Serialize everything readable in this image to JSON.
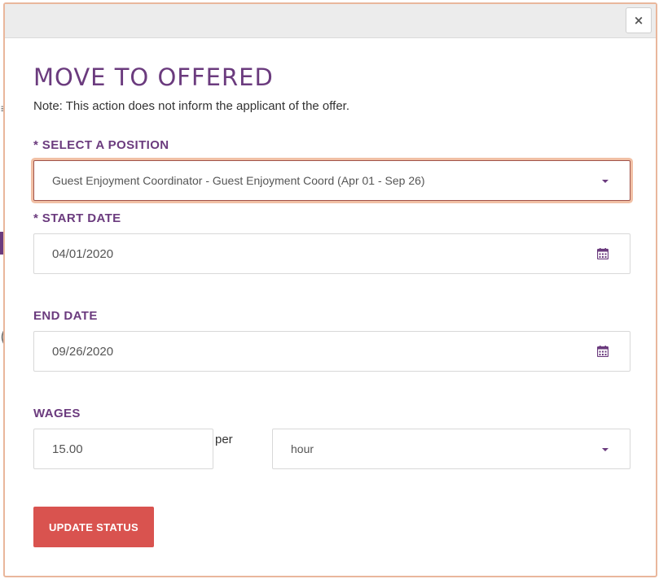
{
  "modal": {
    "close_label": "×",
    "title": "MOVE TO OFFERED",
    "note": "Note: This action does not inform the applicant of the offer."
  },
  "position": {
    "label": "* SELECT A POSITION",
    "value": "Guest Enjoyment Coordinator - Guest Enjoyment Coord (Apr 01 - Sep 26)"
  },
  "start_date": {
    "label": "* START DATE",
    "value": "04/01/2020"
  },
  "end_date": {
    "label": "END DATE",
    "value": "09/26/2020"
  },
  "wages": {
    "label": "WAGES",
    "value": "15.00",
    "per_label": "per",
    "unit": "hour"
  },
  "actions": {
    "update_label": "UPDATE STATUS"
  },
  "colors": {
    "accent": "#6b3b7e",
    "button": "#d9534f",
    "focus_ring": "#f1c0a5"
  },
  "icons": {
    "close": "close-icon",
    "calendar": "calendar-icon",
    "dropdown": "chevron-down-icon"
  }
}
